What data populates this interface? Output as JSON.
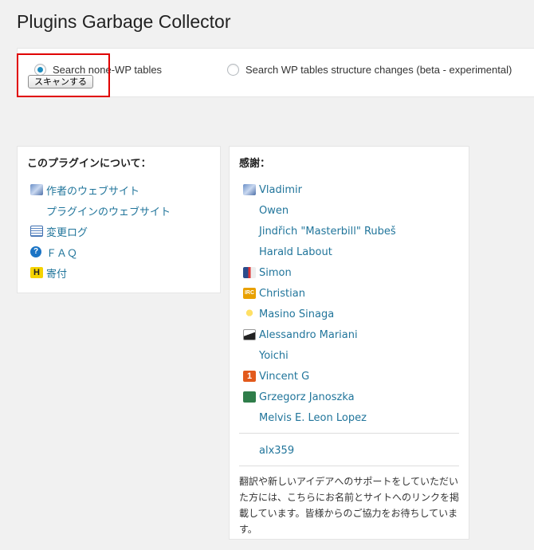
{
  "page": {
    "title": "Plugins Garbage Collector"
  },
  "scan": {
    "option1_label": "Search none-WP tables",
    "option2_label": "Search WP tables structure changes (beta - experimental)",
    "selected": "option1",
    "button_label": "スキャンする"
  },
  "about": {
    "title": "このプラグインについて：",
    "links": [
      {
        "label": "作者のウェブサイト",
        "icon": "author-site-icon"
      },
      {
        "label": "プラグインのウェブサイト",
        "icon": ""
      },
      {
        "label": "変更ログ",
        "icon": "changelog-icon"
      },
      {
        "label": "ＦＡＱ",
        "icon": "faq-icon"
      },
      {
        "label": "寄付",
        "icon": "donate-icon"
      }
    ]
  },
  "thanks": {
    "title": "感謝：",
    "people": [
      {
        "name": "Vladimir",
        "icon": "site-icon"
      },
      {
        "name": "Owen",
        "icon": ""
      },
      {
        "name": "Jindřich \"Masterbill\" Rubeš",
        "icon": ""
      },
      {
        "name": "Harald Labout",
        "icon": ""
      },
      {
        "name": "Simon",
        "icon": "simon-icon"
      },
      {
        "name": "Christian",
        "icon": "christian-icon"
      },
      {
        "name": "Masino Sinaga",
        "icon": "bulb-icon"
      },
      {
        "name": "Alessandro Mariani",
        "icon": "alessandro-icon"
      },
      {
        "name": "Yoichi",
        "icon": ""
      },
      {
        "name": "Vincent G",
        "icon": "number-one-icon"
      },
      {
        "name": "Grzegorz Janoszka",
        "icon": "grzegorz-icon"
      },
      {
        "name": "Melvis E. Leon Lopez",
        "icon": ""
      }
    ],
    "extra": "alx359",
    "note": "翻訳や新しいアイデアへのサポートをしていただいた方には、こちらにお名前とサイトへのリンクを掲載しています。皆様からのご協力をお待ちしています。"
  }
}
